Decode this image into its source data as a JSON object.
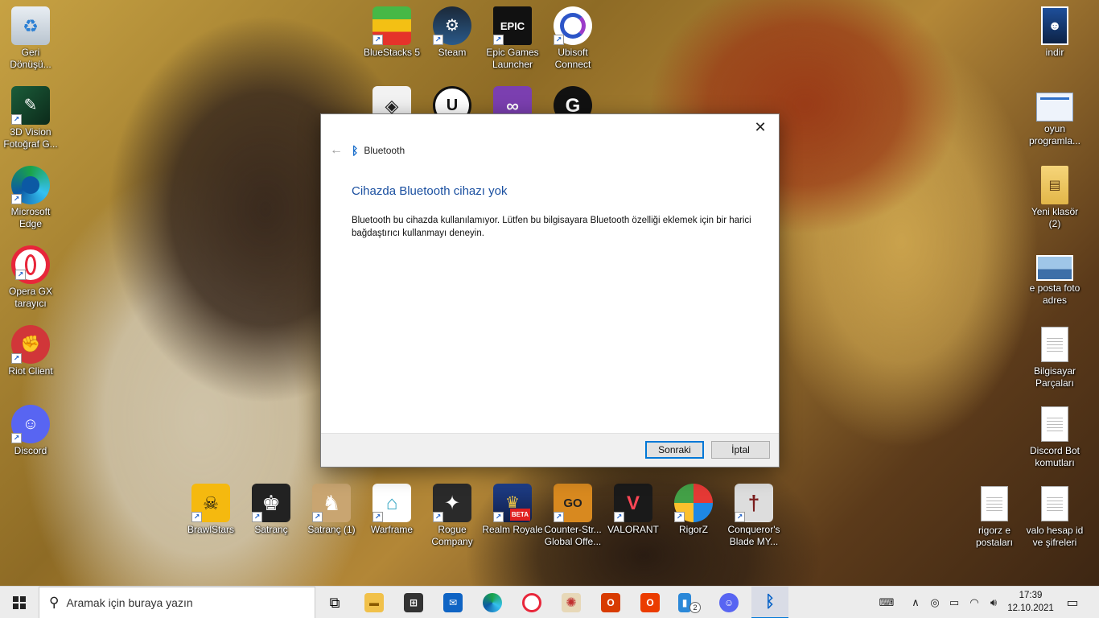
{
  "desktop": {
    "left_column": [
      {
        "label": "Geri Dönüşü...",
        "icon": "recycle-bin-icon"
      },
      {
        "label": "3D Vision Fotoğraf G...",
        "icon": "3d-vision-icon"
      },
      {
        "label": "Microsoft Edge",
        "icon": "edge-icon"
      },
      {
        "label": "Opera GX tarayıcı",
        "icon": "opera-gx-icon"
      },
      {
        "label": "Riot Client",
        "icon": "riot-client-icon"
      },
      {
        "label": "Discord",
        "icon": "discord-icon"
      }
    ],
    "top_row": [
      {
        "label": "BlueStacks 5",
        "icon": "bluestacks-icon"
      },
      {
        "label": "Steam",
        "icon": "steam-icon"
      },
      {
        "label": "Epic Games Launcher",
        "icon": "epic-games-icon",
        "glyph": "EPIC"
      },
      {
        "label": "Ubisoft Connect",
        "icon": "ubisoft-icon"
      }
    ],
    "second_row": [
      {
        "label": "",
        "icon": "unity-icon"
      },
      {
        "label": "",
        "icon": "unreal-engine-icon"
      },
      {
        "label": "",
        "icon": "visual-studio-icon"
      },
      {
        "label": "",
        "icon": "logitech-g-icon"
      }
    ],
    "bottom_row": [
      {
        "label": "BrawlStars",
        "icon": "brawlstars-icon"
      },
      {
        "label": "Satranç",
        "icon": "chess-icon"
      },
      {
        "label": "Satranç (1)",
        "icon": "chess-icon"
      },
      {
        "label": "Warframe",
        "icon": "warframe-icon"
      },
      {
        "label": "Rogue Company",
        "icon": "rogue-company-icon"
      },
      {
        "label": "Realm Royale",
        "icon": "realm-royale-icon",
        "glyph": "BETA"
      },
      {
        "label": "Counter-Str... Global Offe...",
        "icon": "csgo-icon",
        "glyph": "GO"
      },
      {
        "label": "VALORANT",
        "icon": "valorant-icon"
      },
      {
        "label": "RigorZ",
        "icon": "rigorz-icon"
      },
      {
        "label": "Conqueror's Blade MY...",
        "icon": "conquerors-blade-icon"
      }
    ],
    "right_column": [
      {
        "label": "indir",
        "icon": "image-file-icon"
      },
      {
        "label": "oyun programla...",
        "icon": "screenshot-file-icon"
      },
      {
        "label": "Yeni klasör (2)",
        "icon": "folder-icon"
      },
      {
        "label": "e posta foto adres",
        "icon": "image-file-icon"
      },
      {
        "label": "Bilgisayar Parçaları",
        "icon": "text-document-icon"
      },
      {
        "label": "Discord Bot komutları",
        "icon": "text-document-icon"
      },
      {
        "label": "valo hesap id ve şifreleri",
        "icon": "text-document-icon"
      }
    ],
    "extra_doc": {
      "label": "rigorz e postaları",
      "icon": "text-document-icon"
    }
  },
  "dialog": {
    "header": "Bluetooth",
    "title": "Cihazda Bluetooth cihazı yok",
    "message": "Bluetooth bu cihazda kullanılamıyor. Lütfen bu bilgisayara Bluetooth özelliği eklemek için bir harici bağdaştırıcı kullanmayı deneyin.",
    "next_label": "Sonraki",
    "cancel_label": "İptal"
  },
  "taskbar": {
    "search_placeholder": "Aramak için buraya yazın",
    "time": "17:39",
    "date": "12.10.2021",
    "badge_count": "2",
    "accent": "#0078d7"
  }
}
